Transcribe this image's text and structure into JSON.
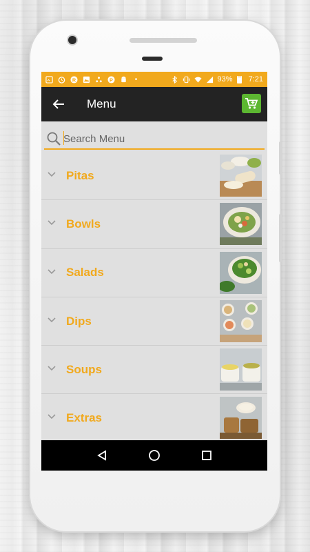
{
  "status_bar": {
    "battery": "93%",
    "time": "7:21",
    "icons": [
      "image-icon",
      "timer-icon",
      "r-app-icon",
      "photo-icon",
      "dots-icon",
      "parking-icon",
      "android-icon",
      "more-icon",
      "bluetooth-icon",
      "vibrate-icon",
      "wifi-icon",
      "signal-icon",
      "battery-icon"
    ]
  },
  "toolbar": {
    "title": "Menu",
    "back_icon": "arrow-left-icon",
    "cart_icon": "cart-icon"
  },
  "search": {
    "placeholder": "Search Menu",
    "value": ""
  },
  "menu": {
    "items": [
      {
        "label": "Pitas"
      },
      {
        "label": "Bowls"
      },
      {
        "label": "Salads"
      },
      {
        "label": "Dips"
      },
      {
        "label": "Soups"
      },
      {
        "label": "Extras"
      }
    ]
  },
  "colors": {
    "accent": "#f1a91d",
    "toolbar": "#232323",
    "cart": "#5cb731",
    "list_bg": "#e0e0e0"
  }
}
